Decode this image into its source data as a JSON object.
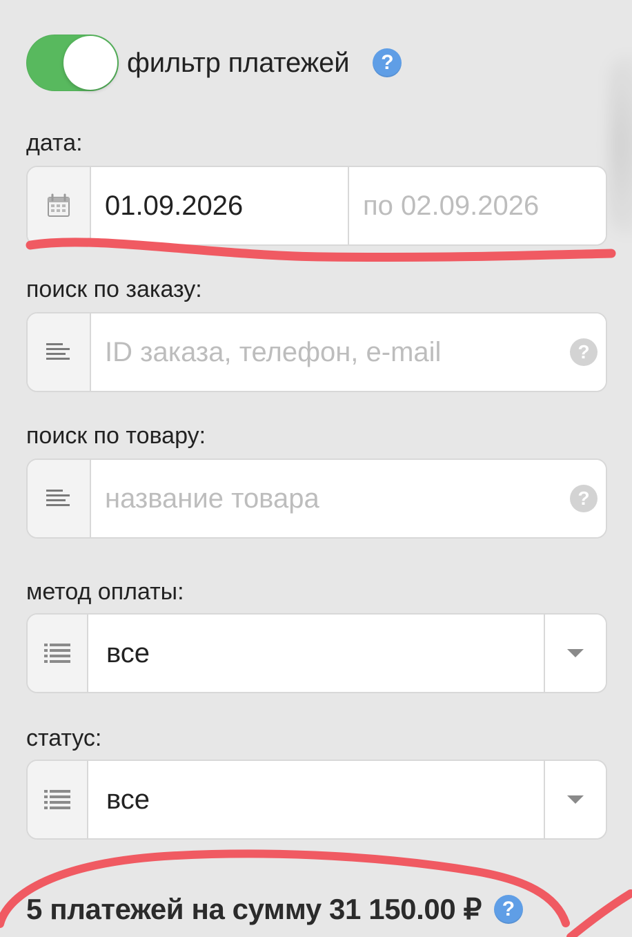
{
  "toggle": {
    "label": "фильтр платежей",
    "state": "on",
    "help_symbol": "?"
  },
  "date_filter": {
    "label": "дата:",
    "from_value": "01.09.2026",
    "to_placeholder": "по 02.09.2026",
    "icon": "calendar-icon"
  },
  "order_search": {
    "label": "поиск по заказу:",
    "placeholder": "ID заказа, телефон, e-mail",
    "icon": "align-left-icon",
    "help_symbol": "?"
  },
  "product_search": {
    "label": "поиск по товару:",
    "placeholder": "название товара",
    "icon": "align-left-icon",
    "help_symbol": "?"
  },
  "payment_method": {
    "label": "метод оплаты:",
    "selected": "все",
    "icon": "list-icon"
  },
  "status": {
    "label": "статус:",
    "selected": "все",
    "icon": "list-icon"
  },
  "summary": {
    "text": "5 платежей на сумму 31 150.00 ₽",
    "help_symbol": "?"
  },
  "colors": {
    "page_background": "#e7e7e7",
    "toggle_on": "#58b95e",
    "help_blue": "#5f9ee6",
    "annotation_red": "#f05a62",
    "border_gray": "#d8d8d8",
    "placeholder_gray": "#bdbdbd"
  }
}
